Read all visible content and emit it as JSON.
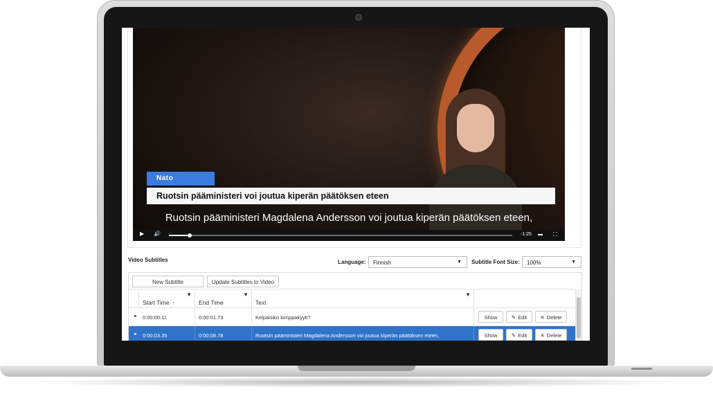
{
  "video": {
    "news_tag": "Nato",
    "headline": "Ruotsin pääministeri voi joutua kiperän päätöksen eteen",
    "subtitle": "Ruotsin pääministeri Magdalena Andersson voi joutua kiperän päätöksen eteen,",
    "time_remaining": "-1:25",
    "progress_fraction": 0.06,
    "icons": {
      "play": "play-icon",
      "volume": "volume-icon",
      "captions": "captions-icon",
      "fullscreen": "fullscreen-icon"
    }
  },
  "editor": {
    "section_title": "Video Subtitles",
    "language_label": "Language:",
    "language_value": "Finnish",
    "font_size_label": "Subtitle Font Size:",
    "font_size_value": "100%",
    "new_subtitle_label": "New Subtitle",
    "update_label": "Update Subtitles to Video",
    "columns": {
      "start": "Start Time",
      "end": "End Time",
      "text": "Text"
    },
    "rows": [
      {
        "start": "0:00:00.11",
        "end": "0:00:01.73",
        "text": "Kelpaisiko kimppakyyti?",
        "selected": false
      },
      {
        "start": "0:00:03.35",
        "end": "0:00:08.78",
        "text": "Ruotsin pääministeri Magdalena Andersson voi joutua kiperän päätöksen eteen,",
        "selected": true
      }
    ],
    "actions": {
      "show": "Show",
      "edit": "Edit",
      "delete": "Delete"
    }
  },
  "colors": {
    "accent": "#3b7be0",
    "selected_row": "#2f74c8",
    "planet_ring": "#b85a2c"
  }
}
